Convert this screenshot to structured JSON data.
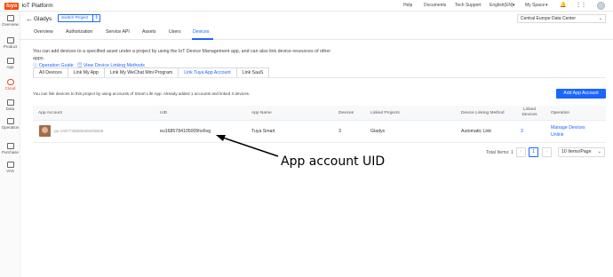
{
  "topbar": {
    "logo_mark": "tuya",
    "logo_text": "IoT Platform",
    "nav": [
      "Help",
      "Documents",
      "Tech Support",
      "English(EN)",
      "My Space"
    ],
    "nav_chevron": "chevron-down-icon"
  },
  "sidebar": {
    "items": [
      {
        "label": "Overview",
        "icon": "home-icon"
      },
      {
        "label": "Product",
        "icon": "product-icon"
      },
      {
        "label": "App",
        "icon": "app-icon"
      },
      {
        "label": "Cloud",
        "icon": "cloud-icon",
        "active": true
      },
      {
        "label": "Data",
        "icon": "data-icon"
      },
      {
        "label": "Operation",
        "icon": "operation-icon"
      },
      {
        "label": "Purchase",
        "icon": "cart-icon"
      },
      {
        "label": "VAS",
        "icon": "vas-icon"
      }
    ]
  },
  "header": {
    "project_name": "Gladys",
    "switch_label": "Switch Project",
    "switch_caret": "⇕",
    "region": "Central Europe Data Center",
    "tabs": [
      "Overview",
      "Authorization",
      "Service API",
      "Assets",
      "Users",
      "Devices"
    ],
    "active_tab": "Devices"
  },
  "description": {
    "text": "You can add devices to a specified asset under a project by using the IoT Device Management app, and can also link device resources of other apps.",
    "link1": "Operation Guide",
    "link2": "View Device Linking Methods"
  },
  "subtabs": [
    "All Devices",
    "Link My App",
    "Link My WeChat Mini Program",
    "Link Tuya App Account",
    "Link SaaS"
  ],
  "link_info": "You can link devices to this project by using accounts of Smart Life App. Already added 1 accounts and linked 3 devices.",
  "add_button": "Add App Account",
  "table": {
    "headers": [
      "App Account",
      "UID",
      "App Name",
      "Devices",
      "Linked Projects",
      "Device Linking Method",
      "Linked Devices",
      "Operation"
    ],
    "row": {
      "account": "pp-1037738585509209609",
      "uid": "eu1685784105005hx6vg",
      "app_name": "Tuya Smart",
      "devices": "3",
      "linked_projects": "Gladys",
      "linking_method": "Automatic Link",
      "linked_devices": "3",
      "op1": "Manage Devices",
      "op2": "Unlink"
    }
  },
  "pagination": {
    "total": "Total Items: 1",
    "current_page": "1",
    "page_size": "10 Items/Page"
  },
  "annotation": {
    "text": "App account UID"
  }
}
